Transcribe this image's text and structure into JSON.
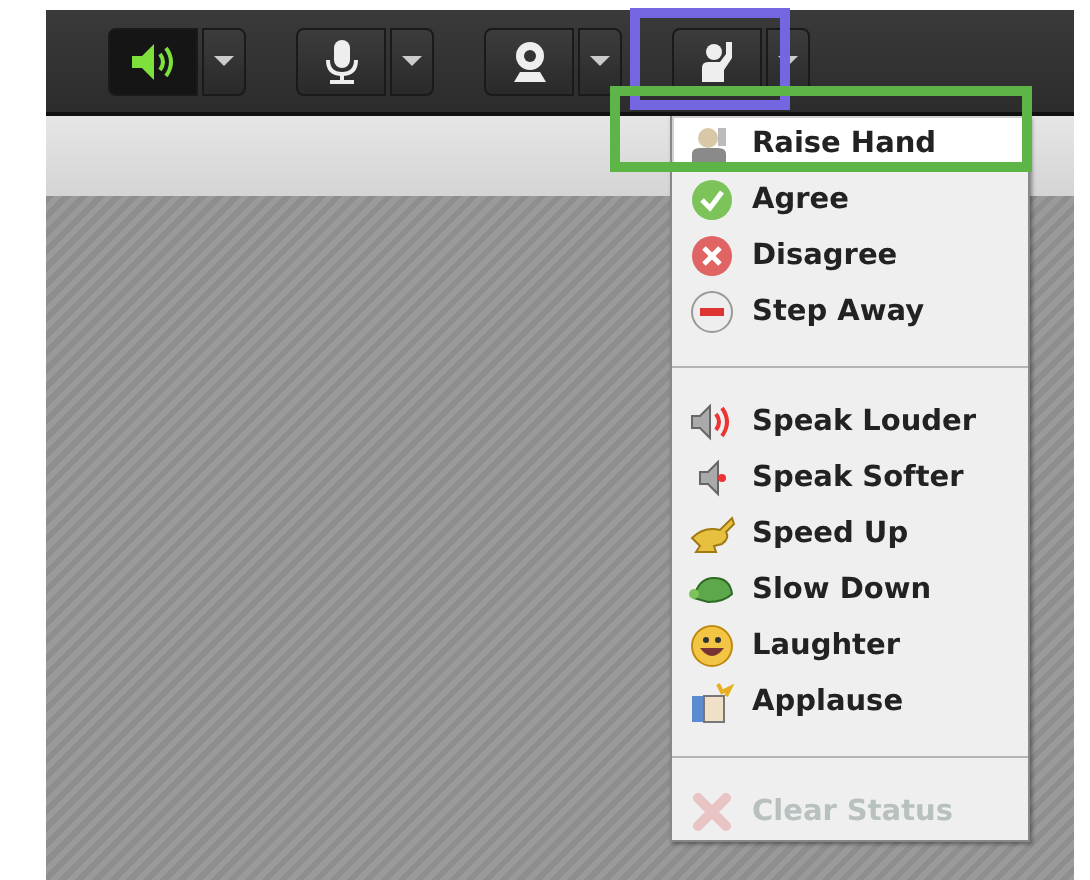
{
  "toolbar": {
    "buttons": [
      {
        "selected": true
      },
      {
        "selected": false
      },
      {
        "selected": false
      },
      {
        "selected": false
      }
    ]
  },
  "status_menu": {
    "items": [
      {
        "kind": "item",
        "label": "Raise Hand",
        "selected": true,
        "disabled": false
      },
      {
        "kind": "item",
        "label": "Agree",
        "selected": false,
        "disabled": false
      },
      {
        "kind": "item",
        "label": "Disagree",
        "selected": false,
        "disabled": false
      },
      {
        "kind": "item",
        "label": "Step Away",
        "selected": false,
        "disabled": false
      },
      {
        "kind": "separator"
      },
      {
        "kind": "item",
        "label": "Speak Louder",
        "selected": false,
        "disabled": false
      },
      {
        "kind": "item",
        "label": "Speak Softer",
        "selected": false,
        "disabled": false
      },
      {
        "kind": "item",
        "label": "Speed Up",
        "selected": false,
        "disabled": false
      },
      {
        "kind": "item",
        "label": "Slow Down",
        "selected": false,
        "disabled": false
      },
      {
        "kind": "item",
        "label": "Laughter",
        "selected": false,
        "disabled": false
      },
      {
        "kind": "item",
        "label": "Applause",
        "selected": false,
        "disabled": false
      },
      {
        "kind": "separator"
      },
      {
        "kind": "item",
        "label": "Clear Status",
        "selected": false,
        "disabled": true
      }
    ]
  },
  "annotations": [
    {
      "color": "#7466e0"
    },
    {
      "color": "#5db547"
    }
  ]
}
